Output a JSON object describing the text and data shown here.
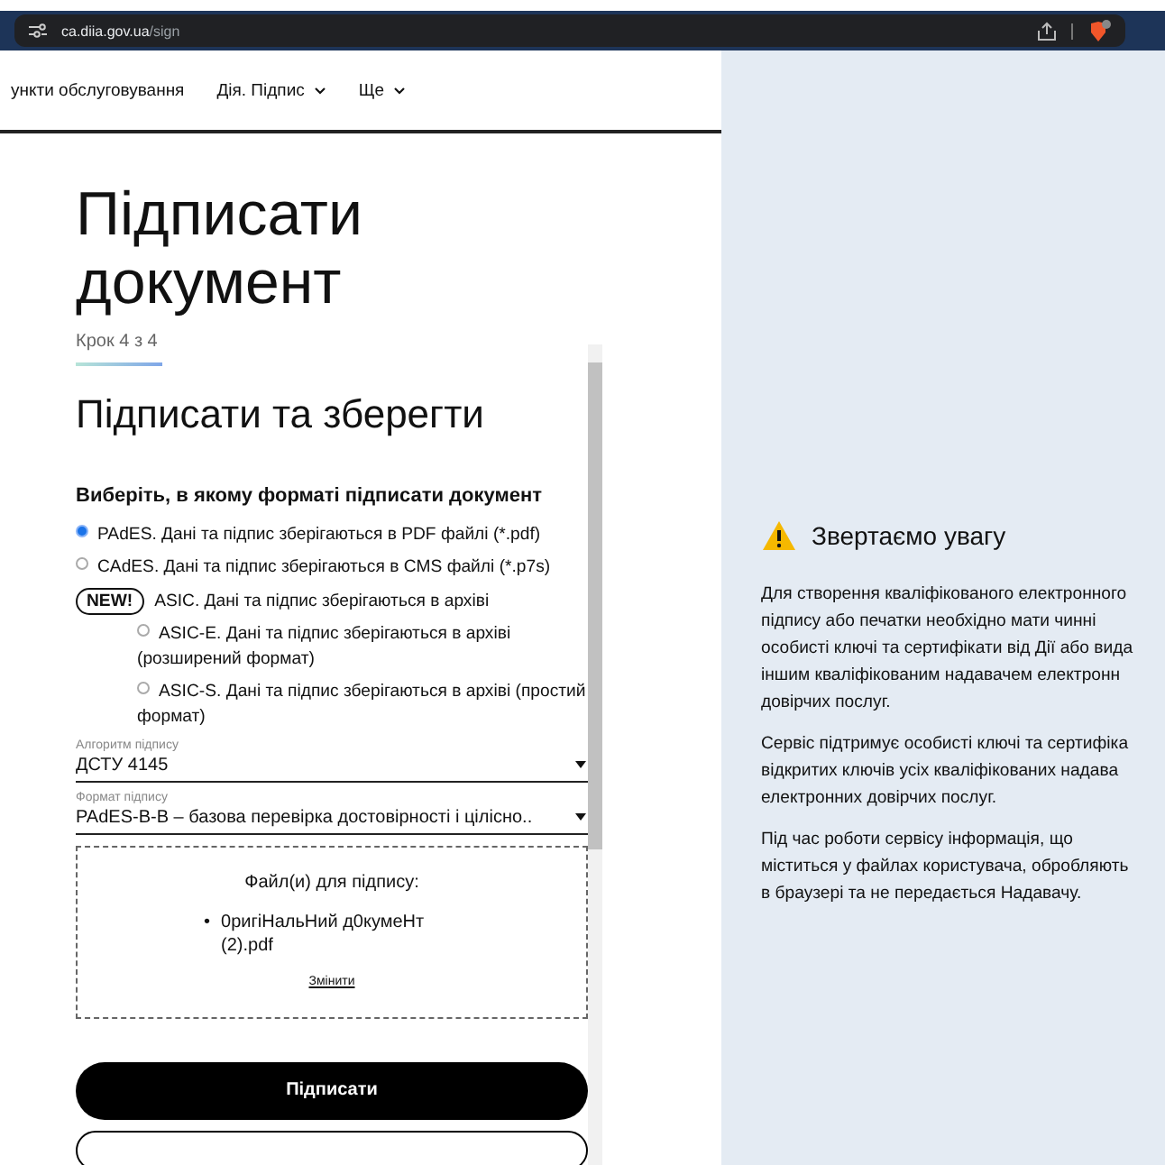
{
  "browser": {
    "url_host": "ca.diia.gov.ua",
    "url_path": "/sign"
  },
  "nav": [
    {
      "label": "ункти обслуговування",
      "dropdown": false
    },
    {
      "label": "Дія. Підпис",
      "dropdown": true
    },
    {
      "label": "Ще",
      "dropdown": true
    }
  ],
  "page_title": "Підписати документ",
  "step": "Крок 4 з 4",
  "section_title": "Підписати та зберегти",
  "format_question": "Виберіть, в якому форматі підписати документ",
  "formats": [
    {
      "kind": "radio",
      "label": "PAdES. Дані та підпис зберігаються в PDF файлі (*.pdf)",
      "selected": true
    },
    {
      "kind": "radio",
      "label": "CAdES. Дані та підпис зберігаються в CMS файлі (*.p7s)",
      "selected": false
    },
    {
      "kind": "group",
      "badge": "NEW!",
      "label": "ASIC. Дані та підпис зберігаються в архіві",
      "children": [
        {
          "label": "ASIC-E. Дані та підпис зберігаються в архіві (розширений формат)",
          "selected": false
        },
        {
          "label": "ASIC-S. Дані та підпис зберігаються в архіві (простий формат)",
          "selected": false
        }
      ]
    }
  ],
  "selects": [
    {
      "label": "Алгоритм підпису",
      "value": "ДСТУ 4145"
    },
    {
      "label": "Формат підпису",
      "value": "PAdES-B-B – базова перевірка достовірності і цілісно.."
    }
  ],
  "files": {
    "title": "Файл(и) для підпису:",
    "items": [
      {
        "bullet": "•",
        "name": "0ригіНальНий д0кумеНт (2).pdf"
      }
    ],
    "change_link": "Змінити"
  },
  "sign_button": "Підписати",
  "notice": {
    "title": "Звертаємо увагу",
    "paragraphs": [
      [
        "Для створення кваліфікованого електронного",
        "підпису або печатки необхідно мати чинні",
        "особисті ключі та сертифікати від Дії або вида",
        "іншим кваліфікованим надавачем електронн",
        "довірчих послуг."
      ],
      [
        "Сервіс підтримує особисті ключі та сертифіка",
        "відкритих ключів усіх кваліфікованих надава",
        "електронних довірчих послуг."
      ],
      [
        "Під час роботи сервісу інформація, що",
        "міститься у файлах користувача, обробляють",
        "в браузері та не передається Надавачу."
      ]
    ]
  }
}
